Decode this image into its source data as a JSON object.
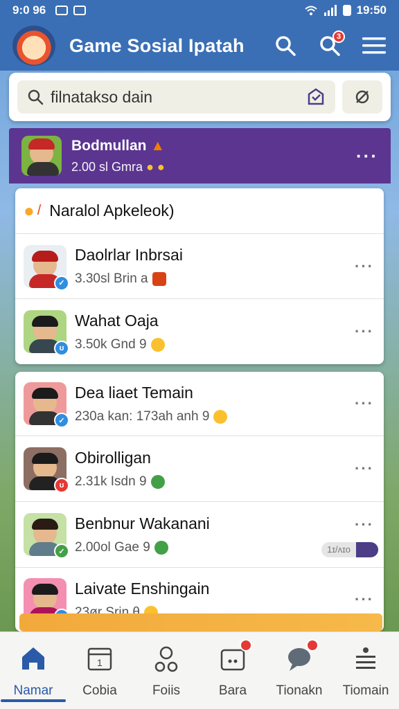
{
  "status": {
    "time_left": "9:0 96",
    "time_right": "19:50"
  },
  "app": {
    "title": "Game Sosial Ipatah"
  },
  "search": {
    "placeholder": "filnatakso dain"
  },
  "featured": {
    "name": "Bodmullan",
    "meta": "2.00 sl Gmra"
  },
  "header_row": {
    "label": "Naralol Apkeleok)"
  },
  "card1": [
    {
      "name": "Daolrlar Inbrsai",
      "meta": "3.30sl Brin a",
      "shirt": "#c62828",
      "hair": "#b71c1c",
      "verify_color": "#2f8ee0",
      "verify_glyph": "✓"
    },
    {
      "name": "Wahat Oaja",
      "meta": "3.50k Gnd 9",
      "shirt": "#37474f",
      "hair": "#1b1b1b",
      "verify_color": "#2f8ee0",
      "verify_glyph": "ʊ"
    }
  ],
  "card2": [
    {
      "name": "Dea liaet Temain",
      "meta": "230a kan: 173ah anh 9",
      "shirt": "#333",
      "hair": "#1b1b1b",
      "verify_color": "#2f8ee0",
      "verify_glyph": "✓"
    },
    {
      "name": "Obirolligan",
      "meta": "2.31k Isdn 9",
      "shirt": "#222",
      "hair": "#1b1b1b",
      "verify_color": "#e53935",
      "verify_glyph": "ʊ"
    },
    {
      "name": "Benbnur Wakanani",
      "meta": "2.00ol Gae 9",
      "shirt": "#607d8b",
      "hair": "#2a1c14",
      "verify_color": "#43a047",
      "verify_glyph": "✓"
    },
    {
      "name": "Laivate Enshingain",
      "meta": "23ør Srin θ",
      "shirt": "#ad1457",
      "hair": "#1b1b1b",
      "verify_color": "#2f8ee0",
      "verify_glyph": "ʊ"
    }
  ],
  "pill": {
    "label": "1ɪ/ʌɪo"
  },
  "nav": [
    {
      "label": "Namar",
      "icon": "home-icon"
    },
    {
      "label": "Cobia",
      "icon": "calendar-icon"
    },
    {
      "label": "Foiis",
      "icon": "friends-icon"
    },
    {
      "label": "Bara",
      "icon": "game-icon"
    },
    {
      "label": "Tionakn",
      "icon": "chat-icon"
    },
    {
      "label": "Tiomain",
      "icon": "list-icon"
    }
  ],
  "colors": {
    "primary": "#3a6fb5",
    "featured": "#5b3590",
    "accent": "#2a5aa8"
  }
}
